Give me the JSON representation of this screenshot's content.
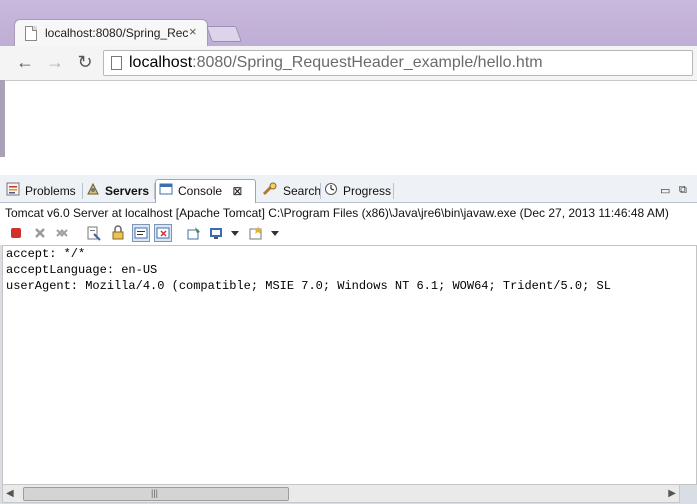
{
  "browser": {
    "tab_title": "localhost:8080/Spring_Rec",
    "tab_close": "×",
    "url_host": "localhost",
    "url_rest": ":8080/Spring_RequestHeader_example/hello.htm",
    "back_glyph": "←",
    "forward_glyph": "→",
    "reload_glyph": "↻"
  },
  "eclipse": {
    "tabs": [
      {
        "label": "Problems",
        "icon": "problems-icon"
      },
      {
        "label": "Servers",
        "icon": "servers-icon"
      },
      {
        "label": "Console",
        "icon": "console-icon"
      },
      {
        "label": "Search",
        "icon": "search-icon"
      },
      {
        "label": "Progress",
        "icon": "progress-icon"
      }
    ],
    "active_tab": "Console",
    "console_close": "⊠",
    "minimize_glyph": "▭",
    "maximize_glyph": "⧉",
    "process_info": "Tomcat v6.0 Server at localhost [Apache Tomcat] C:\\Program Files (x86)\\Java\\jre6\\bin\\javaw.exe (Dec 27, 2013 11:46:48 AM)",
    "console_lines": [
      "accept: */*",
      "acceptLanguage: en-US",
      "userAgent: Mozilla/4.0 (compatible; MSIE 7.0; Windows NT 6.1; WOW64; Trident/5.0; SL"
    ],
    "scroll_grip": "|||",
    "scroll_left": "◀",
    "scroll_right": "▶"
  },
  "colors": {
    "browser_frame": "#c3b2d9",
    "terminate_red": "#d0312d",
    "panel_bg": "#d9dee5"
  }
}
